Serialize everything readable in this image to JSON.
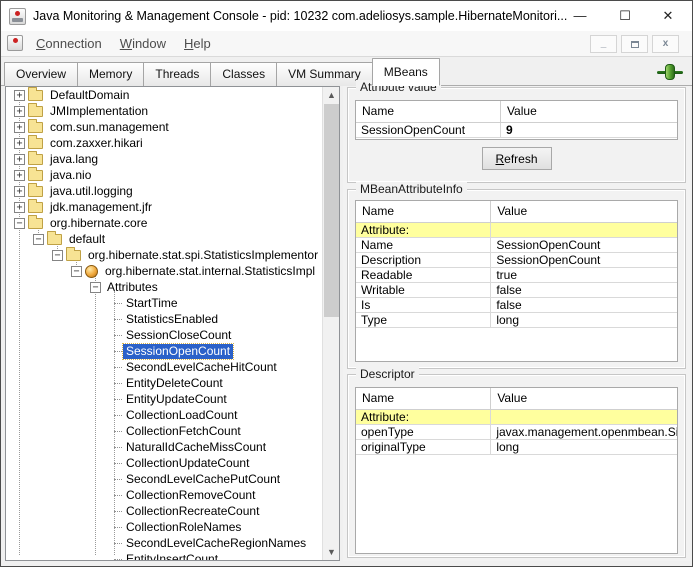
{
  "window": {
    "title": "Java Monitoring & Management Console - pid: 10232 com.adeliosys.sample.HibernateMonitori...",
    "controls": {
      "minimize": "—",
      "maximize": "☐",
      "close": "✕"
    }
  },
  "menubar": {
    "items": [
      {
        "mnemonic": "C",
        "rest": "onnection"
      },
      {
        "mnemonic": "W",
        "rest": "indow"
      },
      {
        "mnemonic": "H",
        "rest": "elp"
      }
    ],
    "frame_controls": {
      "minimize": "_",
      "restore": "",
      "close": "x"
    }
  },
  "tabs": {
    "items": [
      {
        "label": "Overview",
        "active": false
      },
      {
        "label": "Memory",
        "active": false
      },
      {
        "label": "Threads",
        "active": false
      },
      {
        "label": "Classes",
        "active": false
      },
      {
        "label": "VM Summary",
        "active": false
      },
      {
        "label": "MBeans",
        "active": true
      }
    ]
  },
  "colors": {
    "selection_blue": "#2b61c9",
    "row_highlight_yellow": "#ffff9e",
    "folder_yellow": "#f7e394",
    "plug_green": "#53a02e"
  },
  "tree": {
    "items": [
      {
        "label": "DefaultDomain",
        "level": 0,
        "toggle": "plus",
        "icon": "folder",
        "selected": false
      },
      {
        "label": "JMImplementation",
        "level": 0,
        "toggle": "plus",
        "icon": "folder",
        "selected": false
      },
      {
        "label": "com.sun.management",
        "level": 0,
        "toggle": "plus",
        "icon": "folder",
        "selected": false
      },
      {
        "label": "com.zaxxer.hikari",
        "level": 0,
        "toggle": "plus",
        "icon": "folder",
        "selected": false
      },
      {
        "label": "java.lang",
        "level": 0,
        "toggle": "plus",
        "icon": "folder",
        "selected": false
      },
      {
        "label": "java.nio",
        "level": 0,
        "toggle": "plus",
        "icon": "folder",
        "selected": false
      },
      {
        "label": "java.util.logging",
        "level": 0,
        "toggle": "plus",
        "icon": "folder",
        "selected": false
      },
      {
        "label": "jdk.management.jfr",
        "level": 0,
        "toggle": "plus",
        "icon": "folder",
        "selected": false
      },
      {
        "label": "org.hibernate.core",
        "level": 0,
        "toggle": "minus",
        "icon": "folder",
        "selected": false
      },
      {
        "label": "default",
        "level": 1,
        "toggle": "minus",
        "icon": "folder",
        "selected": false
      },
      {
        "label": "org.hibernate.stat.spi.StatisticsImplementor",
        "level": 2,
        "toggle": "minus",
        "icon": "folder",
        "selected": false
      },
      {
        "label": "org.hibernate.stat.internal.StatisticsImpl",
        "level": 3,
        "toggle": "minus",
        "icon": "bean",
        "selected": false
      },
      {
        "label": "Attributes",
        "level": 4,
        "toggle": "minus",
        "icon": null,
        "selected": false
      },
      {
        "label": "StartTime",
        "level": 5,
        "toggle": null,
        "icon": null,
        "selected": false
      },
      {
        "label": "StatisticsEnabled",
        "level": 5,
        "toggle": null,
        "icon": null,
        "selected": false
      },
      {
        "label": "SessionCloseCount",
        "level": 5,
        "toggle": null,
        "icon": null,
        "selected": false
      },
      {
        "label": "SessionOpenCount",
        "level": 5,
        "toggle": null,
        "icon": null,
        "selected": true
      },
      {
        "label": "SecondLevelCacheHitCount",
        "level": 5,
        "toggle": null,
        "icon": null,
        "selected": false
      },
      {
        "label": "EntityDeleteCount",
        "level": 5,
        "toggle": null,
        "icon": null,
        "selected": false
      },
      {
        "label": "EntityUpdateCount",
        "level": 5,
        "toggle": null,
        "icon": null,
        "selected": false
      },
      {
        "label": "CollectionLoadCount",
        "level": 5,
        "toggle": null,
        "icon": null,
        "selected": false
      },
      {
        "label": "CollectionFetchCount",
        "level": 5,
        "toggle": null,
        "icon": null,
        "selected": false
      },
      {
        "label": "NaturalIdCacheMissCount",
        "level": 5,
        "toggle": null,
        "icon": null,
        "selected": false
      },
      {
        "label": "CollectionUpdateCount",
        "level": 5,
        "toggle": null,
        "icon": null,
        "selected": false
      },
      {
        "label": "SecondLevelCachePutCount",
        "level": 5,
        "toggle": null,
        "icon": null,
        "selected": false
      },
      {
        "label": "CollectionRemoveCount",
        "level": 5,
        "toggle": null,
        "icon": null,
        "selected": false
      },
      {
        "label": "CollectionRecreateCount",
        "level": 5,
        "toggle": null,
        "icon": null,
        "selected": false
      },
      {
        "label": "CollectionRoleNames",
        "level": 5,
        "toggle": null,
        "icon": null,
        "selected": false
      },
      {
        "label": "SecondLevelCacheRegionNames",
        "level": 5,
        "toggle": null,
        "icon": null,
        "selected": false
      },
      {
        "label": "EntityInsertCount",
        "level": 5,
        "toggle": null,
        "icon": null,
        "selected": false
      }
    ]
  },
  "panels": {
    "attribute_value": {
      "title": "Attribute value",
      "columns": [
        "Name",
        "Value"
      ],
      "rows": [
        {
          "name": "SessionOpenCount",
          "value": "9",
          "value_bold": true,
          "highlight": false
        }
      ],
      "refresh": {
        "mnemonic": "R",
        "rest": "efresh"
      }
    },
    "mbean_attribute_info": {
      "title": "MBeanAttributeInfo",
      "columns": [
        "Name",
        "Value"
      ],
      "rows": [
        {
          "name": "Attribute:",
          "value": "",
          "highlight": true
        },
        {
          "name": "Name",
          "value": "SessionOpenCount",
          "highlight": false
        },
        {
          "name": "Description",
          "value": "SessionOpenCount",
          "highlight": false
        },
        {
          "name": "Readable",
          "value": "true",
          "highlight": false
        },
        {
          "name": "Writable",
          "value": "false",
          "highlight": false
        },
        {
          "name": "Is",
          "value": "false",
          "highlight": false
        },
        {
          "name": "Type",
          "value": "long",
          "highlight": false
        }
      ]
    },
    "descriptor": {
      "title": "Descriptor",
      "columns": [
        "Name",
        "Value"
      ],
      "rows": [
        {
          "name": "Attribute:",
          "value": "",
          "highlight": true
        },
        {
          "name": "openType",
          "value": "javax.management.openmbean.Sim...",
          "highlight": false
        },
        {
          "name": "originalType",
          "value": "long",
          "highlight": false
        }
      ]
    }
  }
}
